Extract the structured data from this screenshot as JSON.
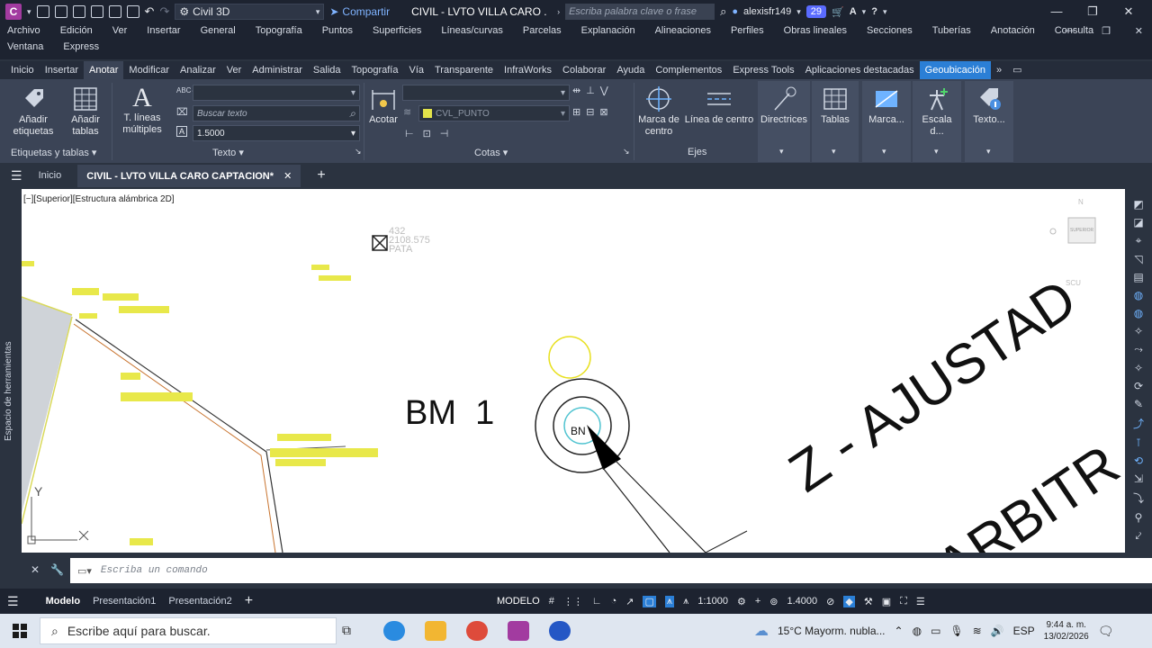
{
  "titlebar": {
    "app_letter": "C",
    "workspace": "Civil 3D",
    "share": "Compartir",
    "doc_title": "CIVIL - LVTO VILLA CARO ...",
    "search_placeholder": "Escriba palabra clave o frase",
    "user": "alexisfr149",
    "badge": "29"
  },
  "menubar": [
    "Archivo",
    "Edición",
    "Ver",
    "Insertar",
    "General",
    "Topografía",
    "Puntos",
    "Superficies",
    "Líneas/curvas",
    "Parcelas",
    "Explanación",
    "Alineaciones",
    "Perfiles",
    "Obras lineales",
    "Secciones",
    "Tuberías",
    "Anotación",
    "Consulta",
    "Ventana",
    "Express"
  ],
  "ribbon_tabs": [
    "Inicio",
    "Insertar",
    "Anotar",
    "Modificar",
    "Analizar",
    "Ver",
    "Administrar",
    "Salida",
    "Topografía",
    "Vía",
    "Transparente",
    "InfraWorks",
    "Colaborar",
    "Ayuda",
    "Complementos",
    "Express Tools",
    "Aplicaciones destacadas",
    "Geoubicación"
  ],
  "ribbon": {
    "add_labels": "Añadir etiquetas",
    "add_tables": "Añadir tablas",
    "mtext": "T. líneas múltiples",
    "search_text": "Buscar texto",
    "text_height": "1.5000",
    "dimension": "Acotar",
    "layer": "CVL_PUNTO",
    "center_mark": "Marca de centro",
    "center_line": "Línea de centro",
    "leaders": "Directrices",
    "tables": "Tablas",
    "markup": "Marca...",
    "scale": "Escala d...",
    "text_btn": "Texto...",
    "group_labels_tables": "Etiquetas y tablas",
    "group_text": "Texto",
    "group_dims": "Cotas",
    "group_axes": "Ejes"
  },
  "doctabs": {
    "home": "Inicio",
    "current": "CIVIL - LVTO VILLA CARO CAPTACION*"
  },
  "canvas": {
    "viewport_label": "[−][Superior][Estructura alámbrica 2D]",
    "point_number": "432",
    "point_elevation": "2108.575",
    "point_desc": "PATA",
    "bm_label": "BM  1",
    "bm_inner": "BN",
    "text_large1": "Z - AJUSTAD",
    "text_large2": "ARBITR",
    "tool_palette": "Espacio de herramientas",
    "axis_y": "Y",
    "viewcube_top": "SUPERIOR",
    "viewcube_n": "N",
    "viewcube_s": "SCU"
  },
  "cmdline": {
    "placeholder": "Escriba un comando"
  },
  "statusbar": {
    "layout_tabs": [
      "Modelo",
      "Presentación1",
      "Presentación2"
    ],
    "model": "MODELO",
    "scale": "1:1000",
    "lineweight": "1.4000"
  },
  "taskbar": {
    "search_placeholder": "Escribe aquí para buscar.",
    "weather": "15°C  Mayorm. nubla...",
    "lang": "ESP",
    "time": "9:44 a. m.",
    "date": "13/02/2026"
  }
}
